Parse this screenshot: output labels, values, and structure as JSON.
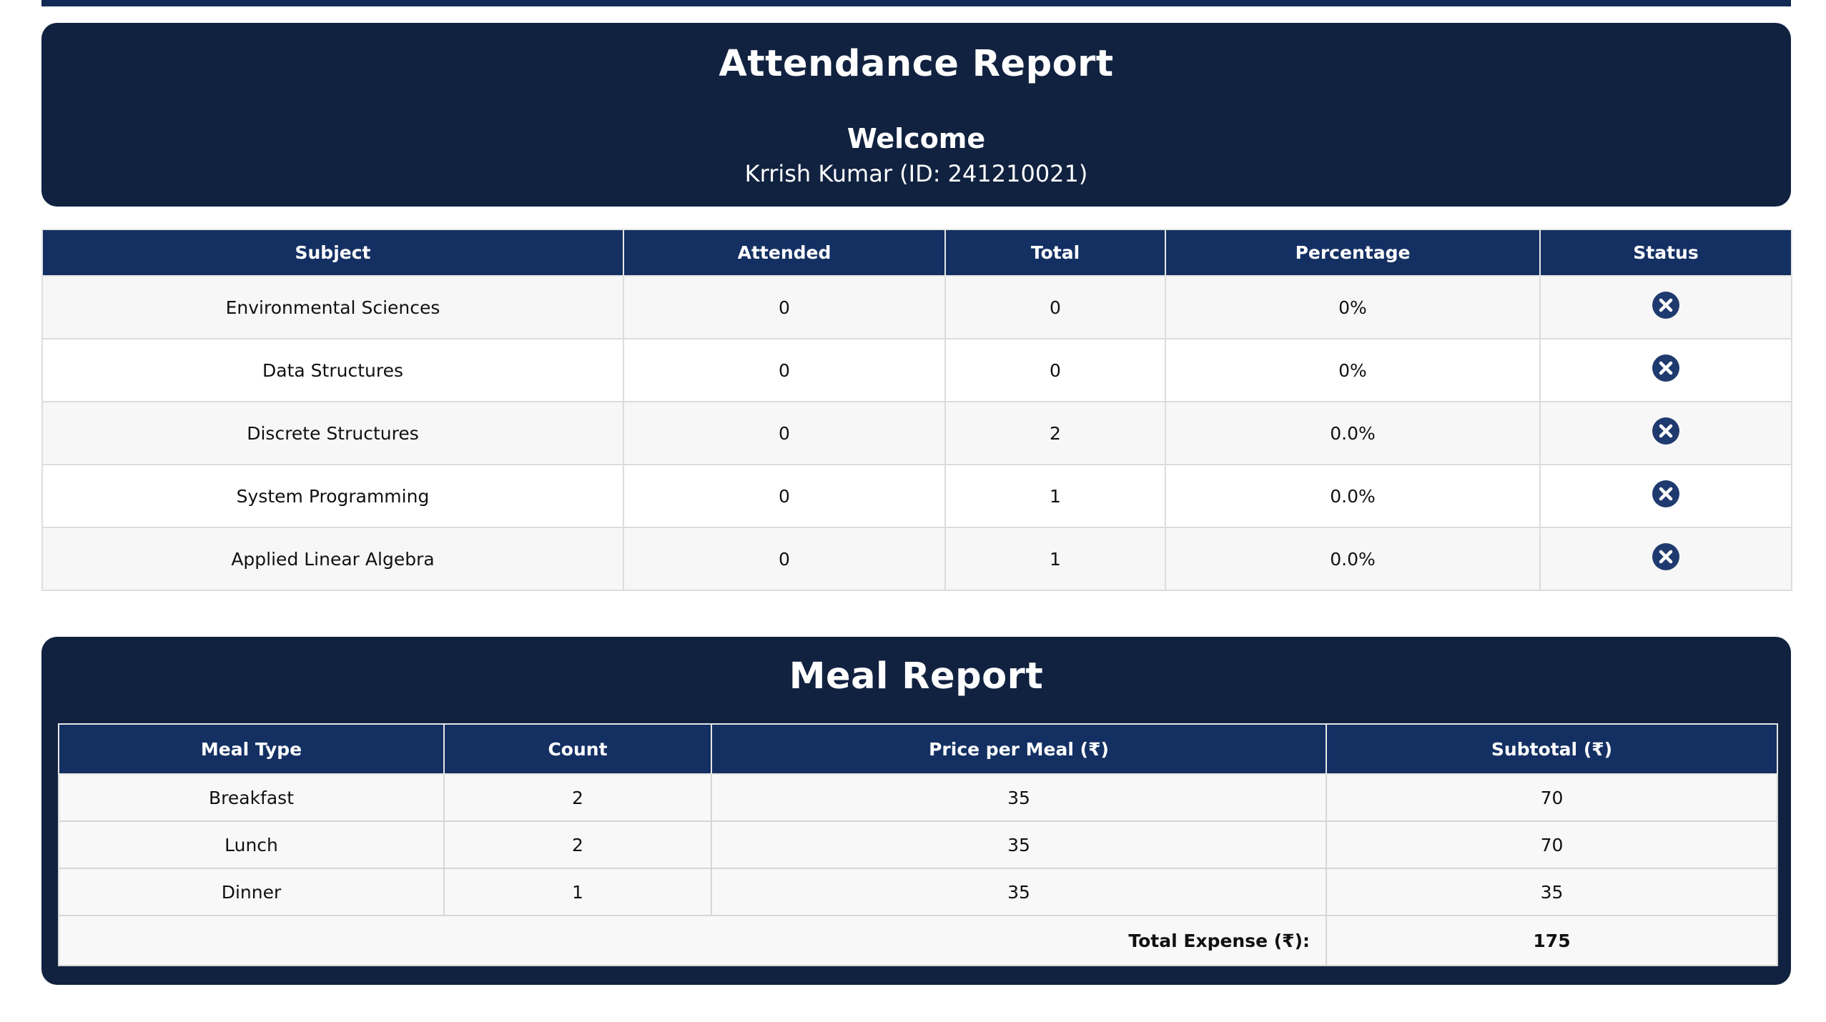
{
  "attendance": {
    "title": "Attendance Report",
    "welcome": "Welcome",
    "student": "Krrish Kumar (ID: 241210021)",
    "columns": [
      "Subject",
      "Attended",
      "Total",
      "Percentage",
      "Status"
    ],
    "rows": [
      {
        "subject": "Environmental Sciences",
        "attended": "0",
        "total": "0",
        "percentage": "0%",
        "status": "x-circle-icon"
      },
      {
        "subject": "Data Structures",
        "attended": "0",
        "total": "0",
        "percentage": "0%",
        "status": "x-circle-icon"
      },
      {
        "subject": "Discrete Structures",
        "attended": "0",
        "total": "2",
        "percentage": "0.0%",
        "status": "x-circle-icon"
      },
      {
        "subject": "System Programming",
        "attended": "0",
        "total": "1",
        "percentage": "0.0%",
        "status": "x-circle-icon"
      },
      {
        "subject": "Applied Linear Algebra",
        "attended": "0",
        "total": "1",
        "percentage": "0.0%",
        "status": "x-circle-icon"
      }
    ]
  },
  "meal": {
    "title": "Meal Report",
    "columns": [
      "Meal Type",
      "Count",
      "Price per Meal (₹)",
      "Subtotal (₹)"
    ],
    "rows": [
      {
        "type": "Breakfast",
        "count": "2",
        "price": "35",
        "subtotal": "70"
      },
      {
        "type": "Lunch",
        "count": "2",
        "price": "35",
        "subtotal": "70"
      },
      {
        "type": "Dinner",
        "count": "1",
        "price": "35",
        "subtotal": "35"
      }
    ],
    "total_label": "Total Expense (₹):",
    "total_value": "175"
  },
  "colors": {
    "panel_bg": "#112240",
    "header_bg": "#143063",
    "status_icon": "#1f3a6e"
  }
}
